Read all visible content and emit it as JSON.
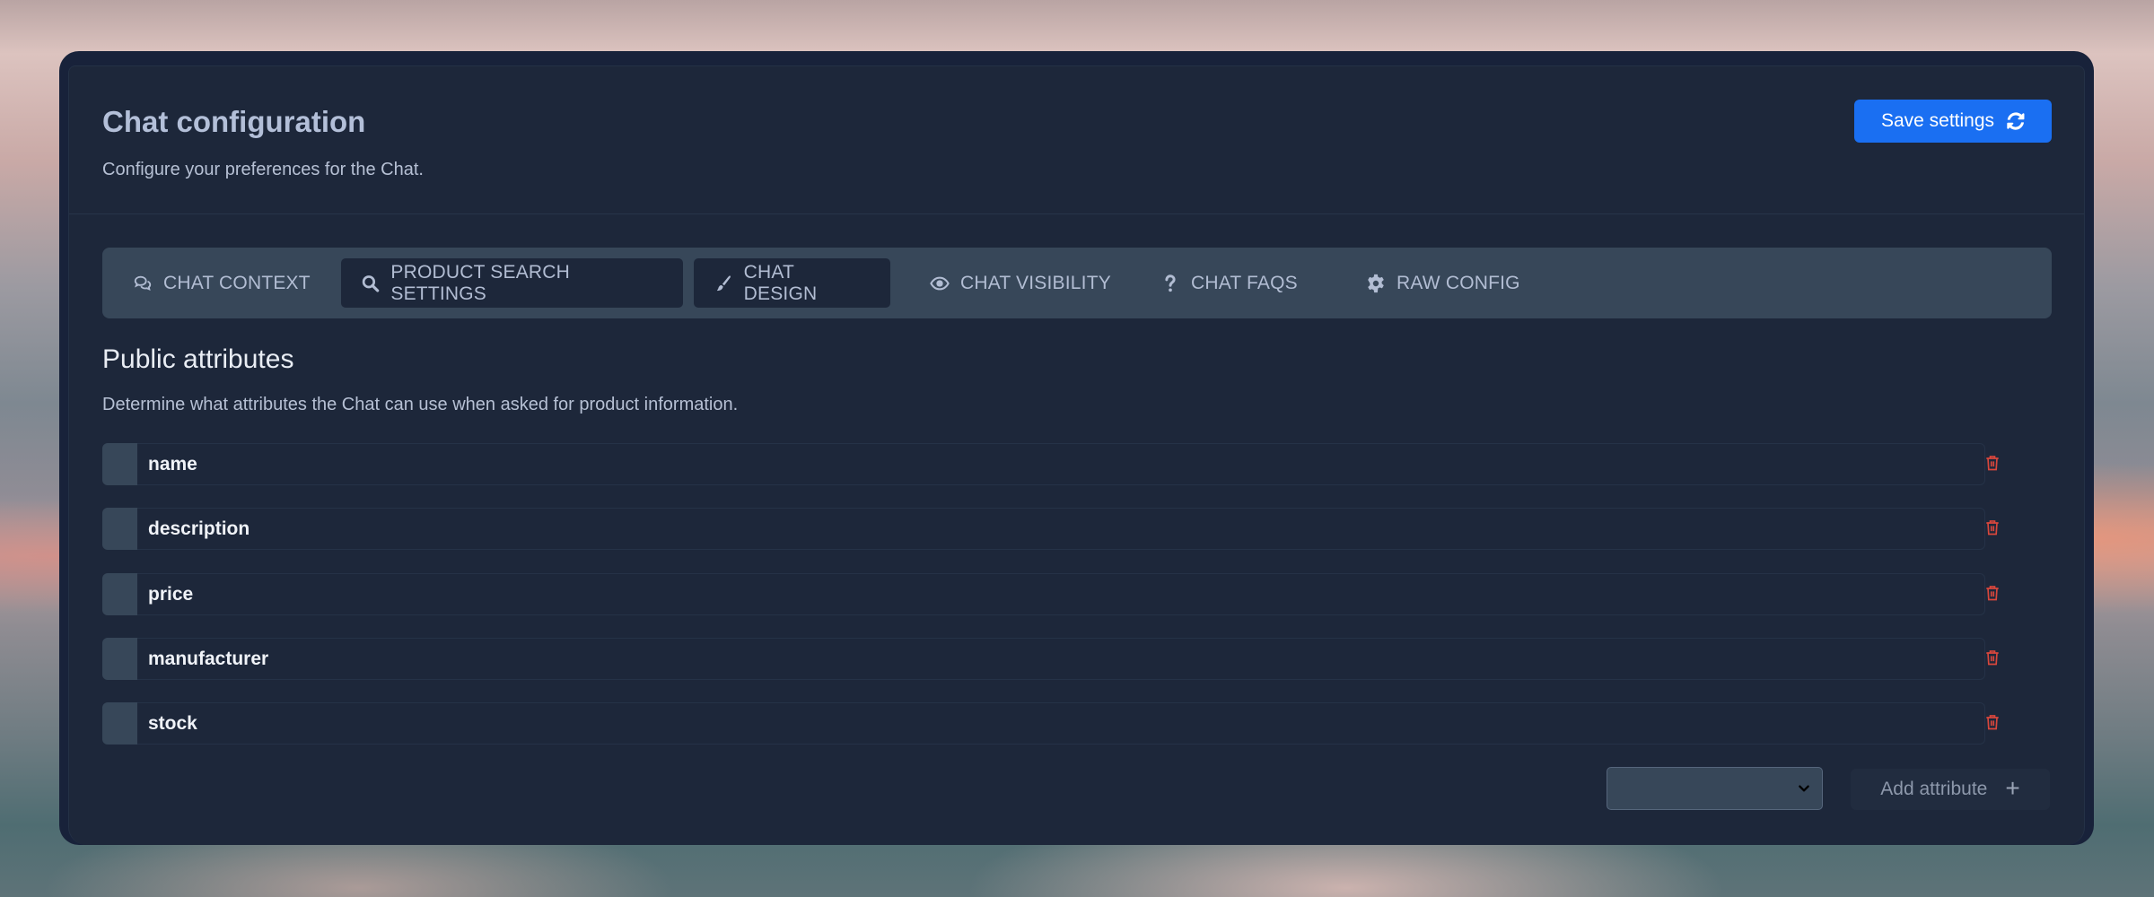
{
  "header": {
    "title": "Chat configuration",
    "subtitle": "Configure your preferences for the Chat.",
    "save_label": "Save settings",
    "save_icon": "refresh-icon"
  },
  "colors": {
    "primary": "#1a6ff2",
    "danger": "#d9473c",
    "panel": "#1d273a",
    "tabbar": "#374759"
  },
  "tabs": [
    {
      "label": "CHAT CONTEXT",
      "icon": "comments-icon",
      "active": false
    },
    {
      "label": "PRODUCT SEARCH SETTINGS",
      "icon": "search-icon",
      "active": true
    },
    {
      "label": "CHAT DESIGN",
      "icon": "paint-brush-icon",
      "active": true
    },
    {
      "label": "CHAT VISIBILITY",
      "icon": "eye-icon",
      "active": false
    },
    {
      "label": "CHAT FAQs",
      "icon": "question-icon",
      "active": false
    },
    {
      "label": "RAW CONFIG",
      "icon": "gear-icon",
      "active": false
    }
  ],
  "section": {
    "title": "Public attributes",
    "description": "Determine what attributes the Chat can use when asked for product information."
  },
  "attributes": [
    {
      "value": "name"
    },
    {
      "value": "description"
    },
    {
      "value": "price"
    },
    {
      "value": "manufacturer"
    },
    {
      "value": "stock"
    }
  ],
  "add": {
    "select_value": "",
    "button_label": "Add attribute",
    "button_icon": "plus-icon"
  }
}
